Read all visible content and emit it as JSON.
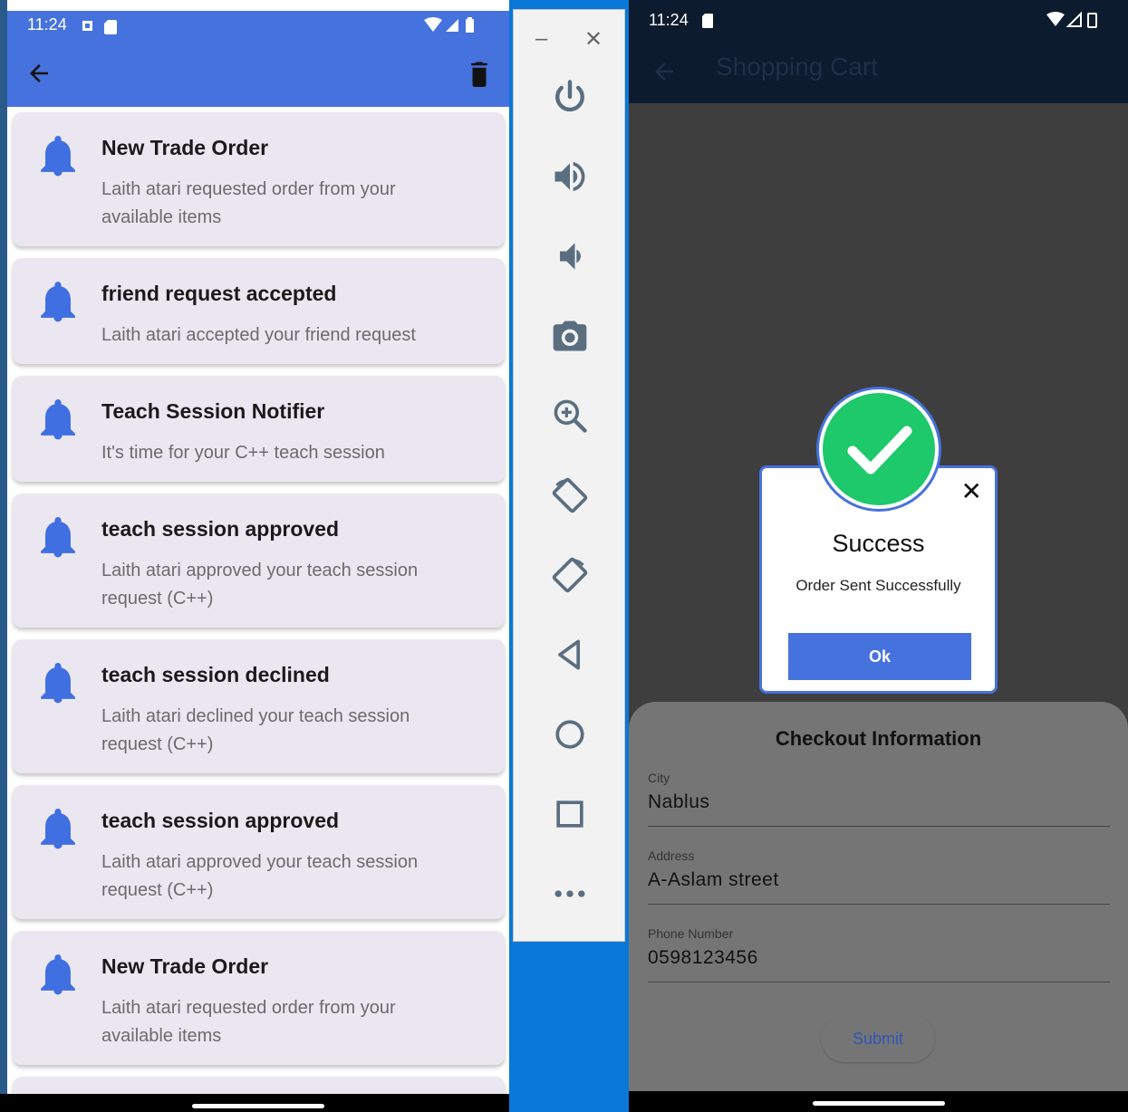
{
  "left_phone": {
    "status": {
      "time": "11:24"
    },
    "notifications": [
      {
        "title": "New Trade Order",
        "message": "Laith atari requested order from your available items"
      },
      {
        "title": "friend request accepted",
        "message": "Laith atari accepted your friend request"
      },
      {
        "title": "Teach Session Notifier",
        "message": "It's time for your C++ teach session"
      },
      {
        "title": "teach session approved",
        "message": "Laith atari approved your teach session request (C++)"
      },
      {
        "title": "teach session declined",
        "message": "Laith atari declined your teach session request (C++)"
      },
      {
        "title": "teach session approved",
        "message": "Laith atari approved your teach session request (C++)"
      },
      {
        "title": "New Trade Order",
        "message": "Laith atari requested order from your available items"
      }
    ]
  },
  "emulator_toolbar": {
    "minimize": "–",
    "close": "✕",
    "buttons": [
      "power-icon",
      "volume-up-icon",
      "volume-down-icon",
      "camera-icon",
      "zoom-icon",
      "rotate-left-icon",
      "rotate-right-icon",
      "back-icon",
      "home-icon",
      "overview-icon",
      "more-icon"
    ]
  },
  "right_phone": {
    "status": {
      "time": "11:24"
    },
    "appbar": {
      "title": "Shopping Cart"
    },
    "dialog": {
      "title": "Success",
      "message": "Order Sent Successfully",
      "ok_label": "Ok",
      "close": "✕"
    },
    "checkout": {
      "heading": "Checkout Information",
      "fields": [
        {
          "label": "City",
          "value": "Nablus"
        },
        {
          "label": "Address",
          "value": "A-Aslam street"
        },
        {
          "label": "Phone Number",
          "value": "0598123456"
        }
      ],
      "submit_label": "Submit"
    }
  },
  "colors": {
    "primary": "#4672dd",
    "success": "#1ec96b",
    "card": "#ebe7f1",
    "dark_bar": "#0d1b2e"
  }
}
